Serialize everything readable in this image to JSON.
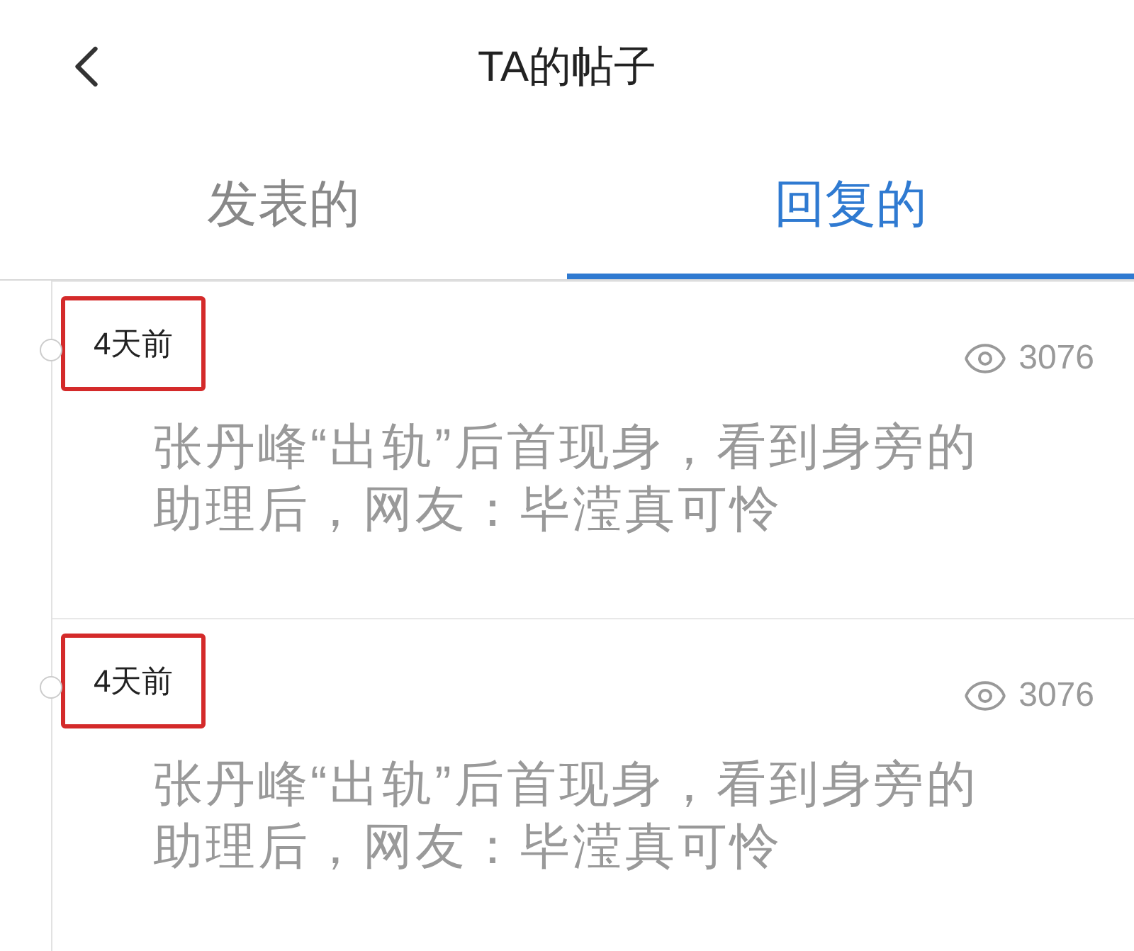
{
  "header": {
    "title": "TA的帖子"
  },
  "tabs": [
    {
      "label": "发表的",
      "selected": false
    },
    {
      "label": "回复的",
      "selected": true
    }
  ],
  "posts": [
    {
      "time": "4天前",
      "highlighted": true,
      "views": "3076",
      "title": "张丹峰“出轨”后首现身，看到身旁的助理后，网友：毕滢真可怜"
    },
    {
      "time": "4天前",
      "highlighted": true,
      "views": "3076",
      "title": "张丹峰“出轨”后首现身，看到身旁的助理后，网友：毕滢真可怜"
    }
  ]
}
